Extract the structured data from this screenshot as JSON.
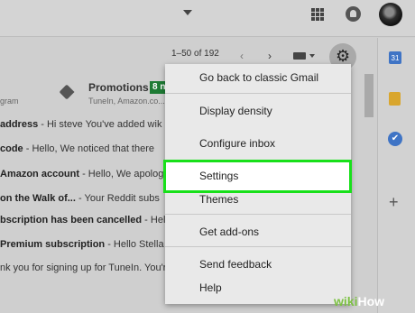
{
  "header": {
    "search_caret_icon": "caret-down-icon",
    "apps_icon": "apps-grid-icon",
    "notifications_icon": "bell-icon",
    "avatar_icon": "avatar"
  },
  "toolbar": {
    "pager_text": "1–50 of 192",
    "prev_icon": "‹",
    "next_icon": "›",
    "gear_icon": "⚙"
  },
  "tabs": {
    "promotions_label": "Promotions",
    "promotions_badge": "8 n",
    "promotions_sub": "TuneIn, Amazon.co...",
    "left_snippet": "gram"
  },
  "emails": [
    {
      "bold": "address",
      "rest": " - Hi steve You've added wik"
    },
    {
      "bold": " code",
      "rest": " - Hello, We noticed that there"
    },
    {
      "bold": "Amazon account",
      "rest": " - Hello, We apologi"
    },
    {
      "bold": "on the Walk of...",
      "rest": " - Your Reddit subs"
    },
    {
      "bold": "bscription has been cancelled",
      "rest": " - Hel"
    },
    {
      "bold": " Premium subscription",
      "rest": " - Hello Stella"
    },
    {
      "bold": "",
      "rest": "nk you for signing up for TuneIn. You're just a click away fr"
    }
  ],
  "menu": {
    "go_back": "Go back to classic Gmail",
    "display_density": "Display density",
    "configure_inbox": "Configure inbox",
    "settings": "Settings",
    "themes": "Themes",
    "get_addons": "Get add-ons",
    "send_feedback": "Send feedback",
    "help": "Help"
  },
  "sidepanel": {
    "calendar_text": "31",
    "tasks_text": "✔",
    "add_text": "+"
  },
  "watermark": {
    "wiki": "wiki",
    "how": "How"
  },
  "colors": {
    "highlight": "#18e01a",
    "badge": "#1e7b34",
    "accent_blue": "#3f74c5"
  }
}
